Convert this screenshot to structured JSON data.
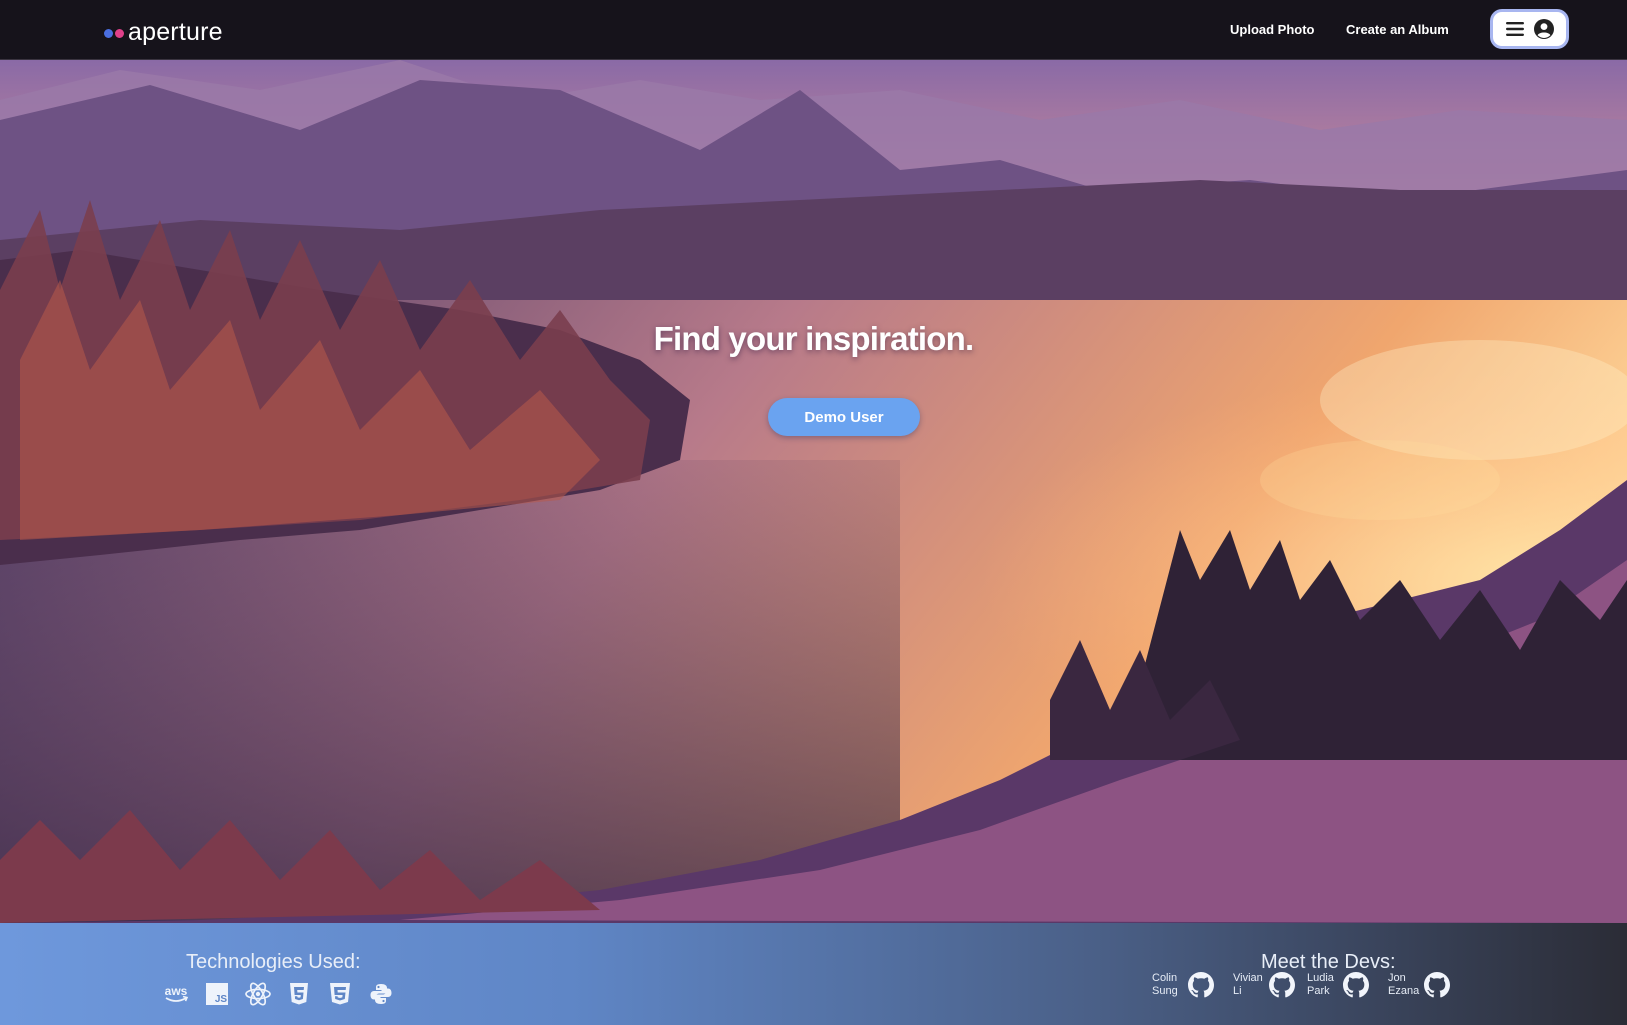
{
  "navbar": {
    "logo_text": "aperture",
    "upload_photo": "Upload Photo",
    "create_album": "Create an Album",
    "menu_icon": "hamburger-menu-icon",
    "user_icon": "user-circle-icon"
  },
  "hero": {
    "title": "Find your inspiration.",
    "demo_button": "Demo User"
  },
  "footer": {
    "technologies_heading": "Technologies Used:",
    "technologies": [
      "aws",
      "javascript",
      "react",
      "html5",
      "css3",
      "python"
    ],
    "devs_heading": "Meet the Devs:",
    "devs": [
      {
        "first": "Colin",
        "last": "Sung",
        "icon": "github-icon"
      },
      {
        "first": "Vivian",
        "last": "Li",
        "icon": "github-icon"
      },
      {
        "first": "Ludia",
        "last": "Park",
        "icon": "github-icon"
      },
      {
        "first": "Jon",
        "last": "Ezana",
        "icon": "github-icon"
      }
    ]
  },
  "colors": {
    "navbar_bg": "#16131b",
    "demo_button": "#6aa3f0",
    "footer_start": "#6e98dc",
    "footer_end": "#2b2c36"
  }
}
